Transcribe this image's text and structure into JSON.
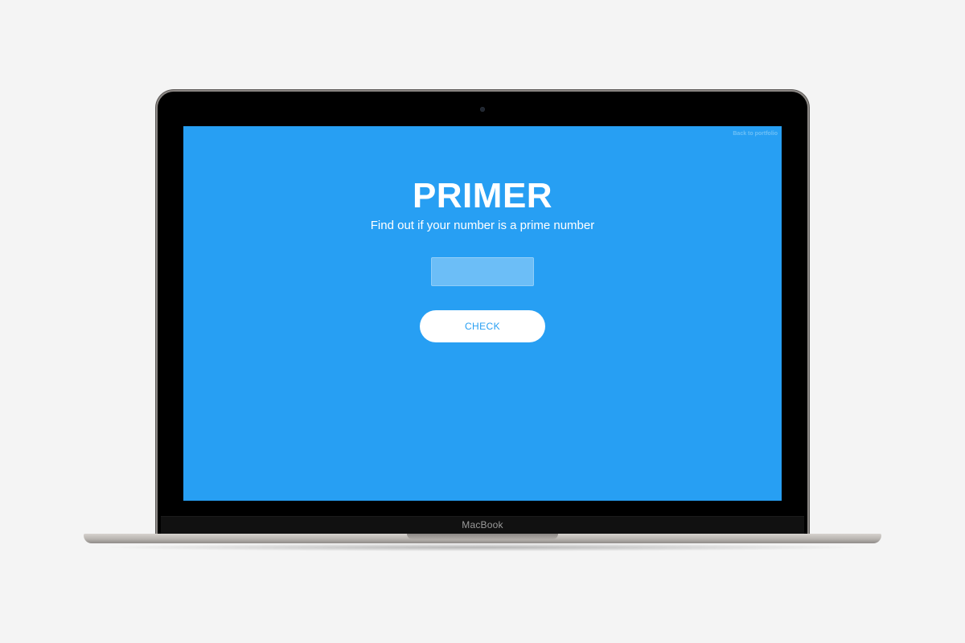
{
  "device": {
    "brand_label": "MacBook"
  },
  "page": {
    "back_link": "Back to portfolio",
    "title": "PRIMER",
    "subtitle": "Find out if your number is a prime number",
    "number_input": {
      "value": "",
      "placeholder": ""
    },
    "check_button_label": "CHECK"
  },
  "colors": {
    "background": "#279ff3",
    "button_bg": "#ffffff",
    "button_text": "#279ff3"
  }
}
